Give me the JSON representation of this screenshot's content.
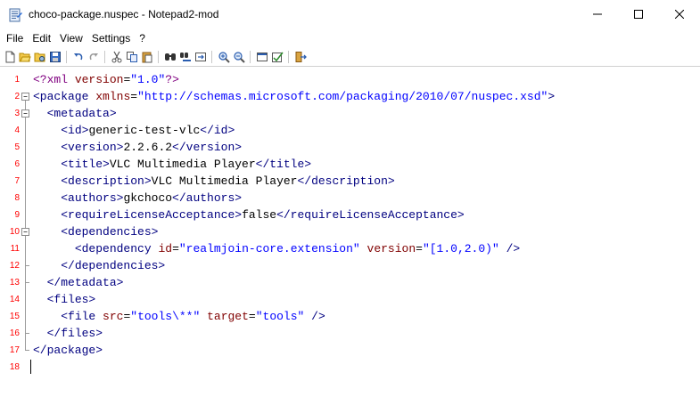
{
  "window": {
    "title": "choco-package.nuspec - Notepad2-mod",
    "app_icon": "notepad-icon",
    "controls": [
      "minimize-icon",
      "maximize-icon",
      "close-icon"
    ]
  },
  "menu": {
    "items": [
      "File",
      "Edit",
      "View",
      "Settings",
      "?"
    ]
  },
  "toolbar": {
    "buttons": [
      "new-file-icon",
      "open-folder-icon",
      "browse-icon",
      "save-icon",
      "undo-icon",
      "redo-icon",
      "cut-icon",
      "copy-icon",
      "paste-icon",
      "find-icon",
      "replace-icon",
      "goto-icon",
      "zoom-in-icon",
      "zoom-out-icon",
      "view-icon",
      "settings-icon",
      "exit-icon"
    ]
  },
  "editor": {
    "line_numbers": [
      "1",
      "2",
      "3",
      "4",
      "5",
      "6",
      "7",
      "8",
      "9",
      "10",
      "11",
      "12",
      "13",
      "14",
      "15",
      "16",
      "17",
      "18"
    ],
    "colors": {
      "line_number": "#ff0000",
      "tag": "#000080",
      "attribute": "#800000",
      "string": "#0000ff",
      "processing_instruction": "#800080",
      "text": "#000000"
    },
    "lines": [
      [
        {
          "t": "pi",
          "v": "<?xml"
        },
        {
          "t": "text",
          "v": " "
        },
        {
          "t": "attr",
          "v": "version"
        },
        {
          "t": "text",
          "v": "="
        },
        {
          "t": "str",
          "v": "\"1.0\""
        },
        {
          "t": "pi",
          "v": "?>"
        }
      ],
      [
        {
          "t": "tag",
          "v": "<package"
        },
        {
          "t": "text",
          "v": " "
        },
        {
          "t": "attr",
          "v": "xmlns"
        },
        {
          "t": "text",
          "v": "="
        },
        {
          "t": "str",
          "v": "\"http://schemas.microsoft.com/packaging/2010/07/nuspec.xsd\""
        },
        {
          "t": "tag",
          "v": ">"
        }
      ],
      [
        {
          "t": "text",
          "v": "  "
        },
        {
          "t": "tag",
          "v": "<metadata>"
        }
      ],
      [
        {
          "t": "text",
          "v": "    "
        },
        {
          "t": "tag",
          "v": "<id>"
        },
        {
          "t": "text",
          "v": "generic-test-vlc"
        },
        {
          "t": "tag",
          "v": "</id>"
        }
      ],
      [
        {
          "t": "text",
          "v": "    "
        },
        {
          "t": "tag",
          "v": "<version>"
        },
        {
          "t": "text",
          "v": "2.2.6.2"
        },
        {
          "t": "tag",
          "v": "</version>"
        }
      ],
      [
        {
          "t": "text",
          "v": "    "
        },
        {
          "t": "tag",
          "v": "<title>"
        },
        {
          "t": "text",
          "v": "VLC Multimedia Player"
        },
        {
          "t": "tag",
          "v": "</title>"
        }
      ],
      [
        {
          "t": "text",
          "v": "    "
        },
        {
          "t": "tag",
          "v": "<description>"
        },
        {
          "t": "text",
          "v": "VLC Multimedia Player"
        },
        {
          "t": "tag",
          "v": "</description>"
        }
      ],
      [
        {
          "t": "text",
          "v": "    "
        },
        {
          "t": "tag",
          "v": "<authors>"
        },
        {
          "t": "text",
          "v": "gkchoco"
        },
        {
          "t": "tag",
          "v": "</authors>"
        }
      ],
      [
        {
          "t": "text",
          "v": "    "
        },
        {
          "t": "tag",
          "v": "<requireLicenseAcceptance>"
        },
        {
          "t": "text",
          "v": "false"
        },
        {
          "t": "tag",
          "v": "</requireLicenseAcceptance>"
        }
      ],
      [
        {
          "t": "text",
          "v": "    "
        },
        {
          "t": "tag",
          "v": "<dependencies>"
        }
      ],
      [
        {
          "t": "text",
          "v": "      "
        },
        {
          "t": "tag",
          "v": "<dependency"
        },
        {
          "t": "text",
          "v": " "
        },
        {
          "t": "attr",
          "v": "id"
        },
        {
          "t": "text",
          "v": "="
        },
        {
          "t": "str",
          "v": "\"realmjoin-core.extension\""
        },
        {
          "t": "text",
          "v": " "
        },
        {
          "t": "attr",
          "v": "version"
        },
        {
          "t": "text",
          "v": "="
        },
        {
          "t": "str",
          "v": "\"[1.0,2.0)\""
        },
        {
          "t": "text",
          "v": " "
        },
        {
          "t": "tag",
          "v": "/>"
        }
      ],
      [
        {
          "t": "text",
          "v": "    "
        },
        {
          "t": "tag",
          "v": "</dependencies>"
        }
      ],
      [
        {
          "t": "text",
          "v": "  "
        },
        {
          "t": "tag",
          "v": "</metadata>"
        }
      ],
      [
        {
          "t": "text",
          "v": "  "
        },
        {
          "t": "tag",
          "v": "<files>"
        }
      ],
      [
        {
          "t": "text",
          "v": "    "
        },
        {
          "t": "tag",
          "v": "<file"
        },
        {
          "t": "text",
          "v": " "
        },
        {
          "t": "attr",
          "v": "src"
        },
        {
          "t": "text",
          "v": "="
        },
        {
          "t": "str",
          "v": "\"tools\\**\""
        },
        {
          "t": "text",
          "v": " "
        },
        {
          "t": "attr",
          "v": "target"
        },
        {
          "t": "text",
          "v": "="
        },
        {
          "t": "str",
          "v": "\"tools\""
        },
        {
          "t": "text",
          "v": " "
        },
        {
          "t": "tag",
          "v": "/>"
        }
      ],
      [
        {
          "t": "text",
          "v": "  "
        },
        {
          "t": "tag",
          "v": "</files>"
        }
      ],
      [
        {
          "t": "tag",
          "v": "</package>"
        }
      ],
      []
    ]
  }
}
